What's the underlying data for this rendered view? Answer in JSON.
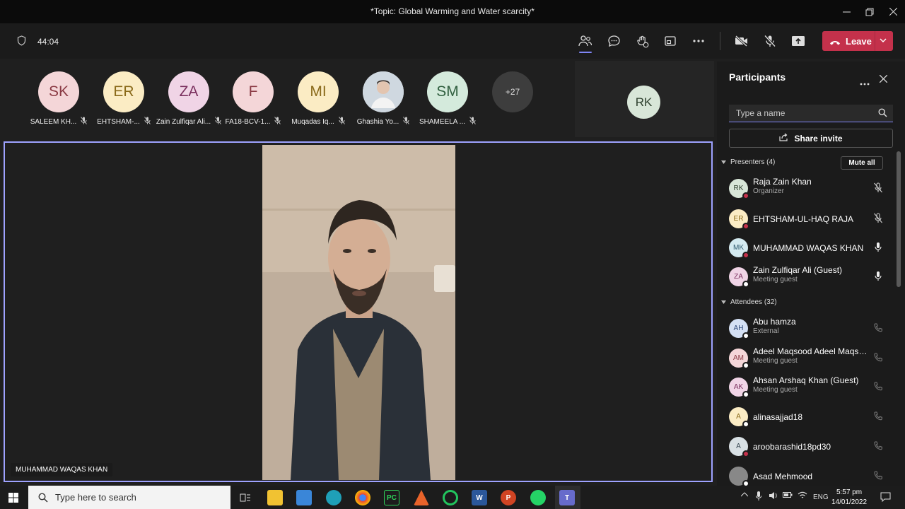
{
  "window": {
    "title": "*Topic: Global Warming and Water scarcity*"
  },
  "toolbar": {
    "timer": "44:04",
    "leave_label": "Leave"
  },
  "gallery": [
    {
      "initials": "SK",
      "name": "SALEEM KH...",
      "bg": "#f4d6d8",
      "fg": "#8a3a44"
    },
    {
      "initials": "ER",
      "name": "EHTSHAM-...",
      "bg": "#fbecc4",
      "fg": "#8a6a1a"
    },
    {
      "initials": "ZA",
      "name": "Zain Zulfiqar Ali...",
      "bg": "#f0d4e6",
      "fg": "#7a2f5e"
    },
    {
      "initials": "F",
      "name": "FA18-BCV-1...",
      "bg": "#f4d6d8",
      "fg": "#8a3a44"
    },
    {
      "initials": "MI",
      "name": "Muqadas Iq...",
      "bg": "#fbecc4",
      "fg": "#8a6a1a"
    },
    {
      "initials": "",
      "name": "Ghashia Yo...",
      "bg": "#cfd8e0",
      "fg": "#333"
    },
    {
      "initials": "SM",
      "name": "SHAMEELA ...",
      "bg": "#d4eadc",
      "fg": "#2f5e3e"
    }
  ],
  "gallery_more": "+27",
  "self_initials": "RK",
  "main_video": {
    "name": "MUHAMMAD WAQAS KHAN"
  },
  "panel": {
    "title": "Participants",
    "search_placeholder": "Type a name",
    "share_label": "Share invite",
    "presenters_label": "Presenters (4)",
    "mute_all_label": "Mute all",
    "attendees_label": "Attendees (32)",
    "presenters": [
      {
        "initials": "RK",
        "name": "Raja Zain Khan",
        "role": "Organizer",
        "bg": "#d8e6d8",
        "fg": "#2c3e2c",
        "dot": "#c4314b",
        "mic": "muted"
      },
      {
        "initials": "ER",
        "name": "EHTSHAM-UL-HAQ RAJA",
        "role": "",
        "bg": "#fbecc4",
        "fg": "#8a6a1a",
        "dot": "#c4314b",
        "mic": "muted"
      },
      {
        "initials": "MK",
        "name": "MUHAMMAD WAQAS KHAN",
        "role": "",
        "bg": "#d4eaf0",
        "fg": "#2f5a6e",
        "dot": "#c4314b",
        "mic": "on"
      },
      {
        "initials": "ZA",
        "name": "Zain Zulfiqar Ali (Guest)",
        "role": "Meeting guest",
        "bg": "#f0d4e6",
        "fg": "#7a2f5e",
        "dot": "#ffffff",
        "mic": "on"
      }
    ],
    "attendees": [
      {
        "initials": "AH",
        "name": "Abu hamza",
        "role": "External",
        "bg": "#d4e0f4",
        "fg": "#2f4a7a",
        "dot": "#ffffff"
      },
      {
        "initials": "AM",
        "name": "Adeel Maqsood Adeel Maqso...",
        "role": "Meeting guest",
        "bg": "#f4d6d8",
        "fg": "#8a3a44",
        "dot": "#ffffff"
      },
      {
        "initials": "AK",
        "name": "Ahsan Arshaq Khan (Guest)",
        "role": "Meeting guest",
        "bg": "#f0d4e6",
        "fg": "#7a2f5e",
        "dot": "#ffffff"
      },
      {
        "initials": "A",
        "name": "alinasajjad18",
        "role": "",
        "bg": "#fbecc4",
        "fg": "#8a6a1a",
        "dot": "#ffffff"
      },
      {
        "initials": "A",
        "name": "aroobarashid18pd30",
        "role": "",
        "bg": "#d8e0e4",
        "fg": "#3a4a54",
        "dot": "#c4314b"
      },
      {
        "initials": "",
        "name": "Asad Mehmood",
        "role": "",
        "bg": "#888888",
        "fg": "#222",
        "dot": "#ffffff"
      }
    ]
  },
  "taskbar": {
    "search_placeholder": "Type here to search",
    "lang": "ENG",
    "time": "5:57 pm",
    "date": "14/01/2022"
  },
  "colors": {
    "accent": "#7f85f5",
    "leave": "#c4314b",
    "spotlight_border": "#9ea2ff"
  }
}
